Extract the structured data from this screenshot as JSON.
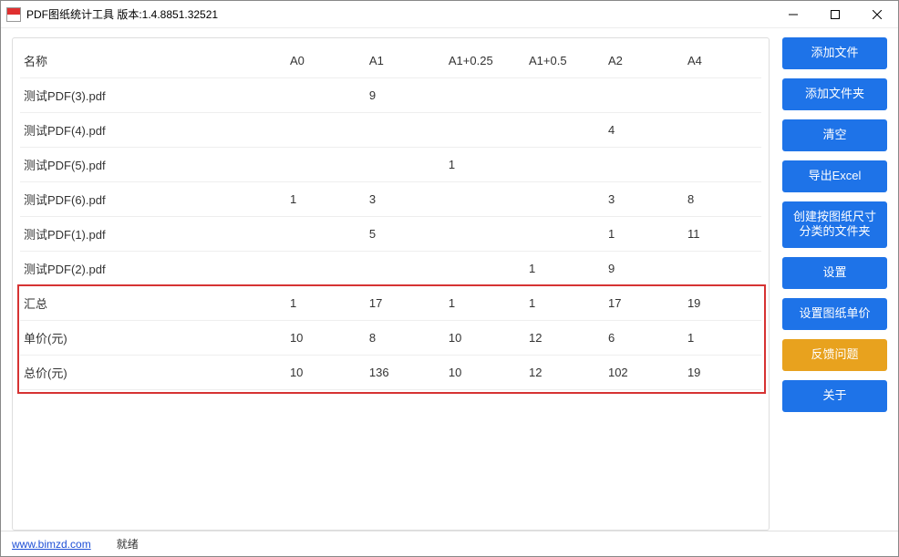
{
  "window": {
    "title": "PDF图纸统计工具 版本:1.4.8851.32521"
  },
  "table": {
    "headers": [
      "名称",
      "A0",
      "A1",
      "A1+0.25",
      "A1+0.5",
      "A2",
      "A4"
    ],
    "rows": [
      {
        "c0": "测试PDF(3).pdf",
        "c1": "",
        "c2": "9",
        "c3": "",
        "c4": "",
        "c5": "",
        "c6": ""
      },
      {
        "c0": "测试PDF(4).pdf",
        "c1": "",
        "c2": "",
        "c3": "",
        "c4": "",
        "c5": "4",
        "c6": ""
      },
      {
        "c0": "测试PDF(5).pdf",
        "c1": "",
        "c2": "",
        "c3": "1",
        "c4": "",
        "c5": "",
        "c6": ""
      },
      {
        "c0": "测试PDF(6).pdf",
        "c1": "1",
        "c2": "3",
        "c3": "",
        "c4": "",
        "c5": "3",
        "c6": "8"
      },
      {
        "c0": "测试PDF(1).pdf",
        "c1": "",
        "c2": "5",
        "c3": "",
        "c4": "",
        "c5": "1",
        "c6": "11"
      },
      {
        "c0": "测试PDF(2).pdf",
        "c1": "",
        "c2": "",
        "c3": "",
        "c4": "1",
        "c5": "9",
        "c6": ""
      },
      {
        "c0": "汇总",
        "c1": "1",
        "c2": "17",
        "c3": "1",
        "c4": "1",
        "c5": "17",
        "c6": "19"
      },
      {
        "c0": "单价(元)",
        "c1": "10",
        "c2": "8",
        "c3": "10",
        "c4": "12",
        "c5": "6",
        "c6": "1"
      },
      {
        "c0": "总价(元)",
        "c1": "10",
        "c2": "136",
        "c3": "10",
        "c4": "12",
        "c5": "102",
        "c6": "19"
      }
    ]
  },
  "buttons": {
    "addFile": "添加文件",
    "addFolder": "添加文件夹",
    "clear": "清空",
    "exportExcel": "导出Excel",
    "createFolders": "创建按图纸尺寸\n分类的文件夹",
    "settings": "设置",
    "setPrice": "设置图纸单价",
    "feedback": "反馈问题",
    "about": "关于"
  },
  "status": {
    "link": "www.bimzd.com",
    "text": "就绪"
  }
}
